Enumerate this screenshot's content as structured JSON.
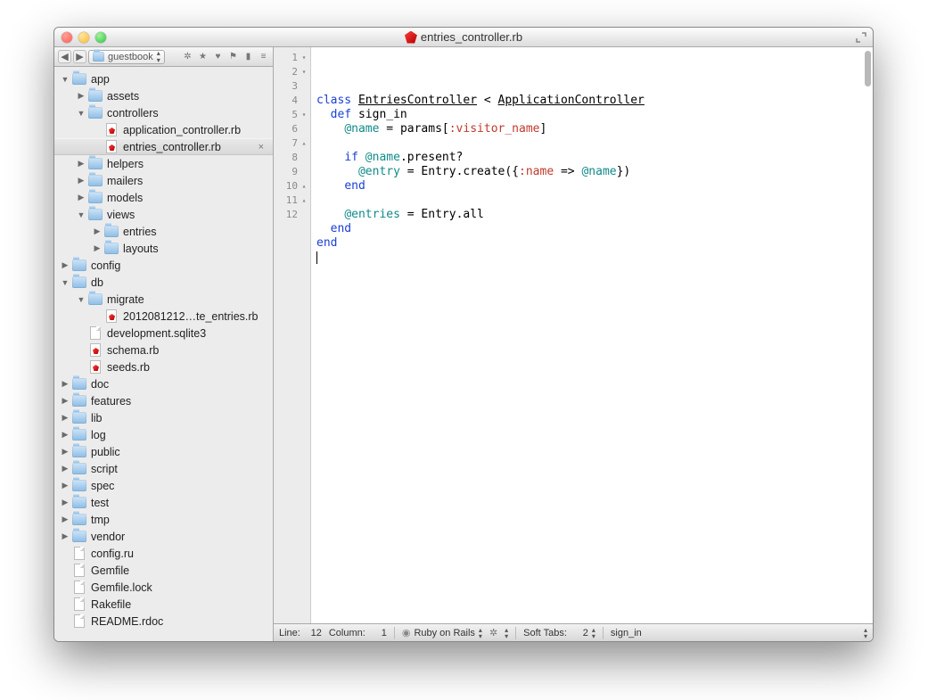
{
  "window": {
    "title": "entries_controller.rb"
  },
  "sidebar": {
    "project": "guestbook",
    "tools": [
      "gear-icon",
      "star-icon",
      "heart-icon",
      "flag-icon",
      "tag-icon",
      "lock-icon"
    ],
    "tree": [
      {
        "depth": 0,
        "disclosure": "down",
        "icon": "folder",
        "label": "app"
      },
      {
        "depth": 1,
        "disclosure": "right",
        "icon": "folder",
        "label": "assets"
      },
      {
        "depth": 1,
        "disclosure": "down",
        "icon": "folder",
        "label": "controllers"
      },
      {
        "depth": 2,
        "disclosure": "",
        "icon": "ruby",
        "label": "application_controller.rb"
      },
      {
        "depth": 2,
        "disclosure": "",
        "icon": "ruby",
        "label": "entries_controller.rb",
        "selected": true,
        "closeable": true
      },
      {
        "depth": 1,
        "disclosure": "right",
        "icon": "folder",
        "label": "helpers"
      },
      {
        "depth": 1,
        "disclosure": "right",
        "icon": "folder",
        "label": "mailers"
      },
      {
        "depth": 1,
        "disclosure": "right",
        "icon": "folder",
        "label": "models"
      },
      {
        "depth": 1,
        "disclosure": "down",
        "icon": "folder",
        "label": "views"
      },
      {
        "depth": 2,
        "disclosure": "right",
        "icon": "folder",
        "label": "entries"
      },
      {
        "depth": 2,
        "disclosure": "right",
        "icon": "folder",
        "label": "layouts"
      },
      {
        "depth": 0,
        "disclosure": "right",
        "icon": "folder",
        "label": "config"
      },
      {
        "depth": 0,
        "disclosure": "down",
        "icon": "folder",
        "label": "db"
      },
      {
        "depth": 1,
        "disclosure": "down",
        "icon": "folder",
        "label": "migrate"
      },
      {
        "depth": 2,
        "disclosure": "",
        "icon": "ruby",
        "label": "2012081212…te_entries.rb"
      },
      {
        "depth": 1,
        "disclosure": "",
        "icon": "file",
        "label": "development.sqlite3"
      },
      {
        "depth": 1,
        "disclosure": "",
        "icon": "ruby",
        "label": "schema.rb"
      },
      {
        "depth": 1,
        "disclosure": "",
        "icon": "ruby",
        "label": "seeds.rb"
      },
      {
        "depth": 0,
        "disclosure": "right",
        "icon": "folder",
        "label": "doc"
      },
      {
        "depth": 0,
        "disclosure": "right",
        "icon": "folder",
        "label": "features"
      },
      {
        "depth": 0,
        "disclosure": "right",
        "icon": "folder",
        "label": "lib"
      },
      {
        "depth": 0,
        "disclosure": "right",
        "icon": "folder",
        "label": "log"
      },
      {
        "depth": 0,
        "disclosure": "right",
        "icon": "folder",
        "label": "public"
      },
      {
        "depth": 0,
        "disclosure": "right",
        "icon": "folder",
        "label": "script"
      },
      {
        "depth": 0,
        "disclosure": "right",
        "icon": "folder",
        "label": "spec"
      },
      {
        "depth": 0,
        "disclosure": "right",
        "icon": "folder",
        "label": "test"
      },
      {
        "depth": 0,
        "disclosure": "right",
        "icon": "folder",
        "label": "tmp"
      },
      {
        "depth": 0,
        "disclosure": "right",
        "icon": "folder",
        "label": "vendor"
      },
      {
        "depth": 0,
        "disclosure": "",
        "icon": "file",
        "label": "config.ru"
      },
      {
        "depth": 0,
        "disclosure": "",
        "icon": "file",
        "label": "Gemfile"
      },
      {
        "depth": 0,
        "disclosure": "",
        "icon": "file",
        "label": "Gemfile.lock"
      },
      {
        "depth": 0,
        "disclosure": "",
        "icon": "file",
        "label": "Rakefile"
      },
      {
        "depth": 0,
        "disclosure": "",
        "icon": "file",
        "label": "README.rdoc"
      }
    ]
  },
  "editor": {
    "lines": [
      {
        "n": 1,
        "fold": "▾",
        "tokens": [
          [
            "kw",
            "class "
          ],
          [
            "const",
            "EntriesController"
          ],
          [
            "punct",
            " < "
          ],
          [
            "const",
            "ApplicationController"
          ]
        ]
      },
      {
        "n": 2,
        "fold": "▾",
        "tokens": [
          [
            "punct",
            "  "
          ],
          [
            "def",
            "def "
          ],
          [
            "defname",
            "sign_in"
          ]
        ]
      },
      {
        "n": 3,
        "fold": "",
        "tokens": [
          [
            "punct",
            "    "
          ],
          [
            "ivar",
            "@name"
          ],
          [
            "punct",
            " = "
          ],
          [
            "name",
            "params"
          ],
          [
            "punct",
            "["
          ],
          [
            "sym",
            ":visitor_name"
          ],
          [
            "punct",
            "]"
          ]
        ]
      },
      {
        "n": 4,
        "fold": "",
        "tokens": [
          [
            "punct",
            ""
          ]
        ]
      },
      {
        "n": 5,
        "fold": "▾",
        "tokens": [
          [
            "punct",
            "    "
          ],
          [
            "kw",
            "if "
          ],
          [
            "ivar",
            "@name"
          ],
          [
            "punct",
            "."
          ],
          [
            "name",
            "present?"
          ]
        ]
      },
      {
        "n": 6,
        "fold": "",
        "tokens": [
          [
            "punct",
            "      "
          ],
          [
            "ivar",
            "@entry"
          ],
          [
            "punct",
            " = "
          ],
          [
            "name",
            "Entry"
          ],
          [
            "punct",
            "."
          ],
          [
            "name",
            "create"
          ],
          [
            "punct",
            "({"
          ],
          [
            "sym",
            ":name"
          ],
          [
            "punct",
            " => "
          ],
          [
            "ivar",
            "@name"
          ],
          [
            "punct",
            "})"
          ]
        ]
      },
      {
        "n": 7,
        "fold": "▴",
        "tokens": [
          [
            "punct",
            "    "
          ],
          [
            "kw",
            "end"
          ]
        ]
      },
      {
        "n": 8,
        "fold": "",
        "tokens": [
          [
            "punct",
            ""
          ]
        ]
      },
      {
        "n": 9,
        "fold": "",
        "tokens": [
          [
            "punct",
            "    "
          ],
          [
            "ivar",
            "@entries"
          ],
          [
            "punct",
            " = "
          ],
          [
            "name",
            "Entry"
          ],
          [
            "punct",
            "."
          ],
          [
            "name",
            "all"
          ]
        ]
      },
      {
        "n": 10,
        "fold": "▴",
        "tokens": [
          [
            "punct",
            "  "
          ],
          [
            "kw",
            "end"
          ]
        ]
      },
      {
        "n": 11,
        "fold": "▴",
        "tokens": [
          [
            "kw",
            "end"
          ]
        ]
      },
      {
        "n": 12,
        "fold": "",
        "tokens": [],
        "caret": true
      }
    ]
  },
  "status": {
    "line_label": "Line:",
    "line_value": "12",
    "col_label": "Column:",
    "col_value": "1",
    "syntax": "Ruby on Rails",
    "tabs_label": "Soft Tabs:",
    "tabs_value": "2",
    "symbol": "sign_in"
  }
}
